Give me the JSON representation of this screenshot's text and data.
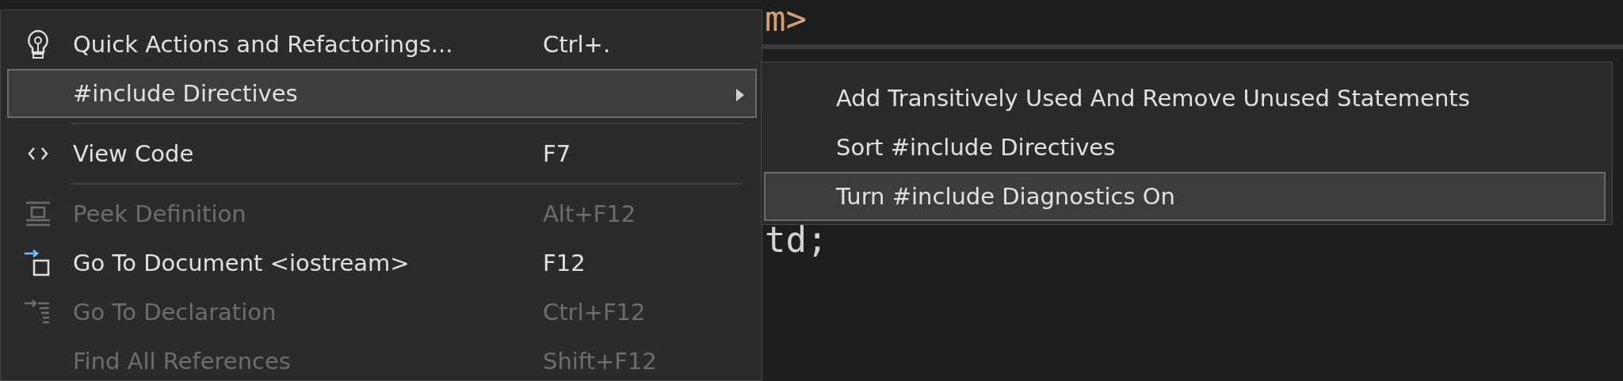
{
  "editor": {
    "lines": [
      {
        "text": "m>",
        "kind": "string"
      },
      {
        "text": "td;",
        "kind": "plain"
      }
    ]
  },
  "context_menu": {
    "items": [
      {
        "kind": "item",
        "label": "Quick Actions and Refactorings...",
        "shortcut": "Ctrl+.",
        "disabled": false,
        "selected": false
      },
      {
        "kind": "item",
        "label": "#include Directives",
        "submenu": true,
        "disabled": false,
        "selected": true
      },
      {
        "kind": "separator"
      },
      {
        "kind": "item",
        "label": "View Code",
        "shortcut": "F7",
        "disabled": false,
        "selected": false
      },
      {
        "kind": "separator"
      },
      {
        "kind": "item",
        "label": "Peek Definition",
        "shortcut": "Alt+F12",
        "disabled": true,
        "selected": false
      },
      {
        "kind": "item",
        "label": "Go To Document <iostream>",
        "shortcut": "F12",
        "disabled": false,
        "selected": false
      },
      {
        "kind": "item",
        "label": "Go To Declaration",
        "shortcut": "Ctrl+F12",
        "disabled": true,
        "selected": false
      },
      {
        "kind": "item",
        "label": "Find All References",
        "shortcut": "Shift+F12",
        "disabled": true,
        "selected": false
      }
    ]
  },
  "submenu": {
    "items": [
      {
        "label": "Add Transitively Used And Remove Unused Statements",
        "selected": false
      },
      {
        "label": "Sort #include Directives",
        "selected": false
      },
      {
        "label": "Turn #include Diagnostics On",
        "selected": true
      }
    ]
  }
}
